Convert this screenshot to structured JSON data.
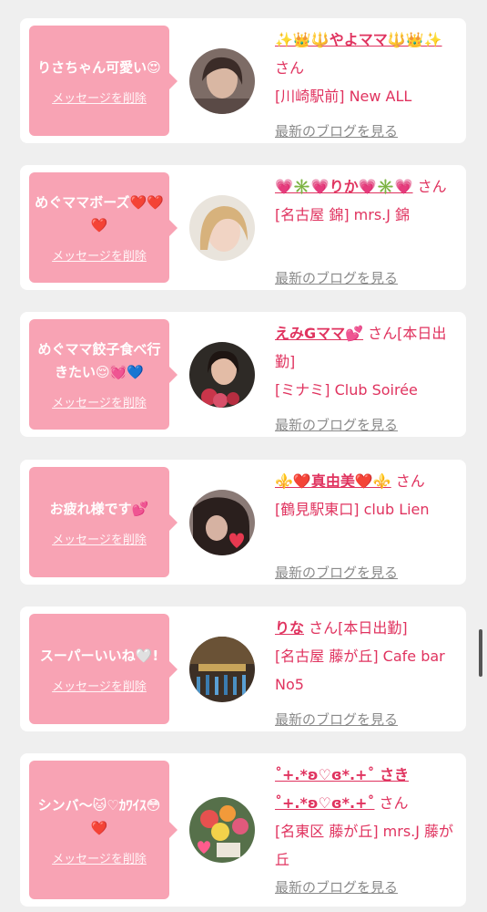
{
  "favorites": [
    {
      "message": "りさちゃん可愛い😍",
      "delete_label": "メッセージを削除",
      "name": "✨👑🔱やよママ🔱👑✨",
      "suffix": "さん",
      "shop": "[川崎駅前] New ALL",
      "blog_label": "最新のブログを見る"
    },
    {
      "message": "めぐママボーズ❤️❤️❤️",
      "delete_label": "メッセージを削除",
      "name": "💗✳️💗りか💗✳️💗",
      "suffix": "さん",
      "shop": "[名古屋 錦] mrs.J 錦",
      "blog_label": "最新のブログを見る"
    },
    {
      "message": "めぐママ餃子食べ行きたい😌💓💙",
      "delete_label": "メッセージを削除",
      "name": "えみGママ💕",
      "suffix": "さん[本日出勤]",
      "shop": "[ミナミ] Club Soirée",
      "blog_label": "最新のブログを見る"
    },
    {
      "message": "お疲れ様です💕",
      "delete_label": "メッセージを削除",
      "name": "⚜️❤️真由美❤️⚜️",
      "suffix": "さん",
      "shop": "[鶴見駅東口] club Lien",
      "blog_label": "最新のブログを見る"
    },
    {
      "message": "スーパーいいね🤍!",
      "delete_label": "メッセージを削除",
      "name": "りな",
      "suffix": "さん[本日出勤]",
      "shop": "[名古屋 藤が丘] Cafe bar No5",
      "blog_label": "最新のブログを見る"
    },
    {
      "message": "シンバ〜🐱♡ｶﾜｲｽ😳❤️",
      "delete_label": "メッセージを削除",
      "name": "˚+.*ʚ♡ɞ*.+˚ さき˚+.*ʚ♡ɞ*.+˚",
      "suffix": "さん",
      "shop": "[名東区 藤が丘] mrs.J 藤が丘",
      "blog_label": "最新のブログを見る"
    }
  ]
}
